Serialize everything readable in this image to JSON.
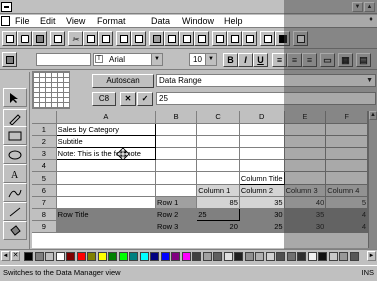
{
  "menubar": {
    "items": [
      "File",
      "Edit",
      "View",
      "Format",
      "Data",
      "Window",
      "Help"
    ]
  },
  "toolbar2": {
    "font_name": "Arial",
    "font_size": "10",
    "bold_label": "B",
    "italic_label": "I",
    "underline_label": "U"
  },
  "data_manager": {
    "autoscan_label": "Autoscan",
    "data_range_label": "Data Range",
    "cell_ref": "C8",
    "cancel_glyph": "✕",
    "accept_glyph": "✓",
    "cell_value": "25"
  },
  "sheet": {
    "columns": [
      "A",
      "B",
      "C",
      "D",
      "E",
      "F"
    ],
    "rows": [
      {
        "num": "1",
        "cells": [
          "Sales by Category",
          "",
          "",
          "",
          "",
          ""
        ]
      },
      {
        "num": "2",
        "cells": [
          "Subtitle",
          "",
          "",
          "",
          "",
          ""
        ]
      },
      {
        "num": "3",
        "cells": [
          "Note: This is the footnote",
          "",
          "",
          "",
          "",
          ""
        ]
      },
      {
        "num": "4",
        "cells": [
          "",
          "",
          "",
          "",
          "",
          ""
        ]
      },
      {
        "num": "5",
        "cells": [
          "",
          "",
          "",
          "Column Title",
          "",
          ""
        ]
      },
      {
        "num": "6",
        "cells": [
          "",
          "",
          "Column 1",
          "Column 2",
          "Column 3",
          "Column 4"
        ]
      },
      {
        "num": "7",
        "cells": [
          "",
          "Row 1",
          "85",
          "35",
          "40",
          "5"
        ]
      },
      {
        "num": "8",
        "cells": [
          "Row Title",
          "Row 2",
          "25",
          "30",
          "35",
          "4"
        ]
      },
      {
        "num": "9",
        "cells": [
          "",
          "Row 3",
          "20",
          "25",
          "30",
          "4"
        ]
      }
    ]
  },
  "status": {
    "message": "Switches to the Data Manager view",
    "mode": "INS"
  },
  "colors": {
    "face": "#c0c0c0",
    "shadow": "#808080",
    "palette": [
      "#000000",
      "#808080",
      "#c0c0c0",
      "#ffffff",
      "#800000",
      "#ff0000",
      "#808000",
      "#ffff00",
      "#008000",
      "#00ff00",
      "#008080",
      "#00ffff",
      "#000080",
      "#0000ff",
      "#800080",
      "#ff00ff",
      "#404040",
      "#a0a0a0",
      "#606060",
      "#e0e0e0",
      "#202020",
      "#909090",
      "#b0b0b0",
      "#d0d0d0",
      "#505050",
      "#707070",
      "#303030",
      "#f0f0f0",
      "#101010",
      "#c8c8c8",
      "#989898",
      "#585858"
    ]
  }
}
